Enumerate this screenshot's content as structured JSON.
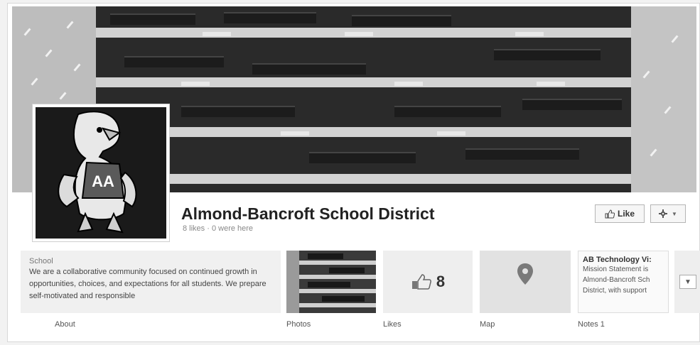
{
  "page": {
    "title": "Almond-Bancroft School District",
    "subtitle": "8 likes · 0 were here"
  },
  "actions": {
    "like_label": "Like",
    "settings_arrow": "▼"
  },
  "about": {
    "category": "School",
    "description": "We are a collaborative community focused on continued growth in opportunities, choices, and expectations for all students. We prepare self-motivated and responsible"
  },
  "apps": {
    "likes_count": "8",
    "notes_title": "AB Technology Vi:",
    "notes_lines": [
      "Mission Statement is",
      "Almond-Bancroft Sch",
      "District, with support"
    ]
  },
  "tabs": {
    "about": "About",
    "photos": "Photos",
    "likes": "Likes",
    "map": "Map",
    "notes": "Notes 1"
  },
  "icons": {
    "thumb": "thumbs-up-icon",
    "gear": "gear-icon",
    "pin": "map-pin-icon",
    "expand": "chevron-down-icon"
  },
  "colors": {
    "frame_bg": "#ffffff",
    "title": "#222222",
    "muted": "#888888"
  }
}
